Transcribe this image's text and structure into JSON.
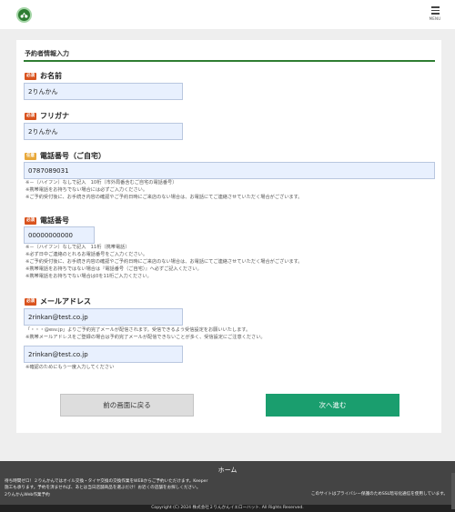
{
  "header": {
    "menu_label": "MENU"
  },
  "form": {
    "section_title": "予約者情報入力",
    "name": {
      "badge": "必須",
      "label": "お名前",
      "value": "2りんかん"
    },
    "kana": {
      "badge": "必須",
      "label": "フリガナ",
      "value": "2りんかん"
    },
    "home_phone": {
      "badge": "任意",
      "label": "電話番号（ご自宅）",
      "value": "0787089031",
      "notes": [
        "※－（ハイフン）なしで記入　10桁（市外局番含むご自宅の電話番号）",
        "※携帯電話をお持ちでない場合には必ずご入力ください。",
        "※ご予約受付後に、お手続き内容の確認やご予約日時にご来店のない場合は、お電話にてご連絡させていただく場合がございます。"
      ]
    },
    "mobile_phone": {
      "badge": "必須",
      "label": "電話番号",
      "value": "00000000000",
      "notes": [
        "※－（ハイフン）なしで記入　11桁（携帯電話）",
        "※必ず日中ご連絡のとれるお電話番号をご入力ください。",
        "※ご予約受付後に、お手続き内容の確認やご予約日時にご来店のない場合は、お電話にてご連絡させていただく場合がございます。",
        "※携帯電話をお持ちではない場合は『電話番号（ご自宅）』へ必ずご記入ください。",
        "※携帯電話をお持ちでない場合は0を11桁ご入力ください。"
      ]
    },
    "email": {
      "badge": "必須",
      "label": "メールアドレス",
      "value": "2rinkan@test.co.jp",
      "notes": [
        "「・・・@esv.jp」よりご予約完了メールが配信されます。受信できるよう受信設定をお願いいたします。",
        "※携帯メールアドレスをご登録の場合は予約完了メールが配信できないことが多く、受信設定にご注意ください。"
      ],
      "confirm_value": "2rinkan@test.co.jp",
      "confirm_note": "※確認のためにもう一度入力してください"
    },
    "back_button": "前の画面に戻る",
    "next_button": "次へ進む"
  },
  "footer": {
    "home": "ホーム",
    "info_lines": [
      "待ち時間ゼロ！２りんかんではオイル交換・タイヤ交換の交換作業をWEBからご予約いただけます。Keeper",
      "施工も承ります。予約を済ませれば、あとは当日店舗商品を選ぶだけ！お近くの店舗をお探しください。",
      "2りんかんWeb作業予約"
    ],
    "privacy": "このサイトはプライバシー保護のためSSL暗号化通信を使用しています。",
    "copyright": "Copyright (C) 2024 株式会社２りんかんイエローハット. All Rights Reserved."
  }
}
